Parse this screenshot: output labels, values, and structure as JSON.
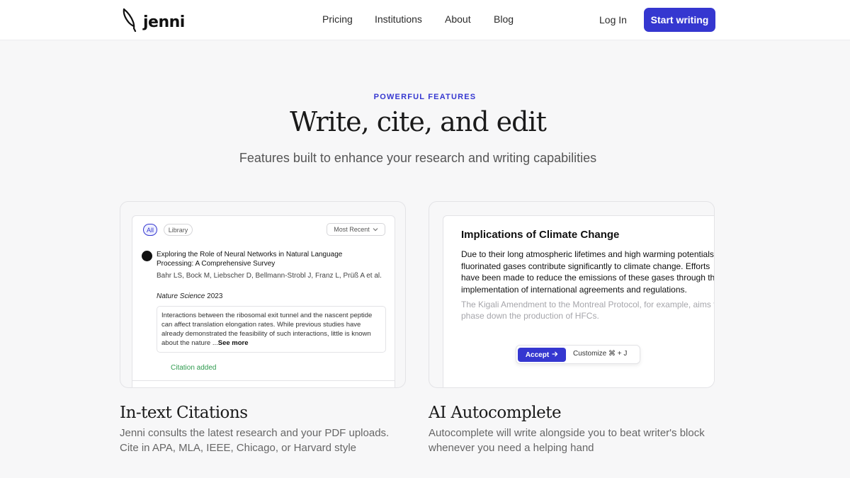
{
  "header": {
    "brand": "jenni",
    "nav": [
      {
        "label": "Pricing"
      },
      {
        "label": "Institutions"
      },
      {
        "label": "About"
      },
      {
        "label": "Blog"
      }
    ],
    "login_label": "Log In",
    "cta_label": "Start writing"
  },
  "hero": {
    "eyebrow": "POWERFUL FEATURES",
    "headline": "Write, cite, and edit",
    "subhead": "Features built to enhance your research and writing capabilities"
  },
  "citations_card": {
    "filter_all": "All",
    "filter_library": "Library",
    "sort_label": "Most Recent",
    "paper_title": "Exploring the Role of Neural Networks in Natural Language Processing: A Comprehensive Survey",
    "paper_authors": "Bahr LS, Bock M, Liebscher D, Bellmann-Strobl J, Franz L, Prüß A et al.",
    "paper_journal": "Nature Science",
    "paper_year": "2023",
    "abstract": "Interactions between the ribosomal exit tunnel and the nascent peptide can affect translation elongation rates. While previous studies have already demonstrated the feasibility of such interactions, little is known about the nature ...",
    "see_more": "See more",
    "status": "Citation added",
    "caption_title": "In-text Citations",
    "caption_desc": "Jenni consults the latest research and your PDF uploads. Cite in APA, MLA, IEEE, Chicago, or Harvard style"
  },
  "autocomplete_card": {
    "doc_title": "Implications of Climate Change",
    "doc_body": "Due to their long atmospheric lifetimes and high warming potentials, fluorinated gases contribute significantly to climate change. Efforts have been made to reduce the emissions of these gases through the implementation of international agreements and regulations.",
    "doc_suggestion": "The Kigali Amendment to the Montreal Protocol, for example, aims to phase down the production of HFCs.",
    "accept_label": "Accept",
    "customize_label": "Customize ⌘ + J",
    "caption_title": "AI Autocomplete",
    "caption_desc": "Autocomplete will write alongside you to beat writer's block whenever you need a helping hand"
  },
  "colors": {
    "accent": "#3537d0",
    "success": "#2f9b4f",
    "background": "#f7f7f8"
  },
  "icons": [
    "quill-logo-icon",
    "chevron-down-icon",
    "arrow-right-icon"
  ]
}
